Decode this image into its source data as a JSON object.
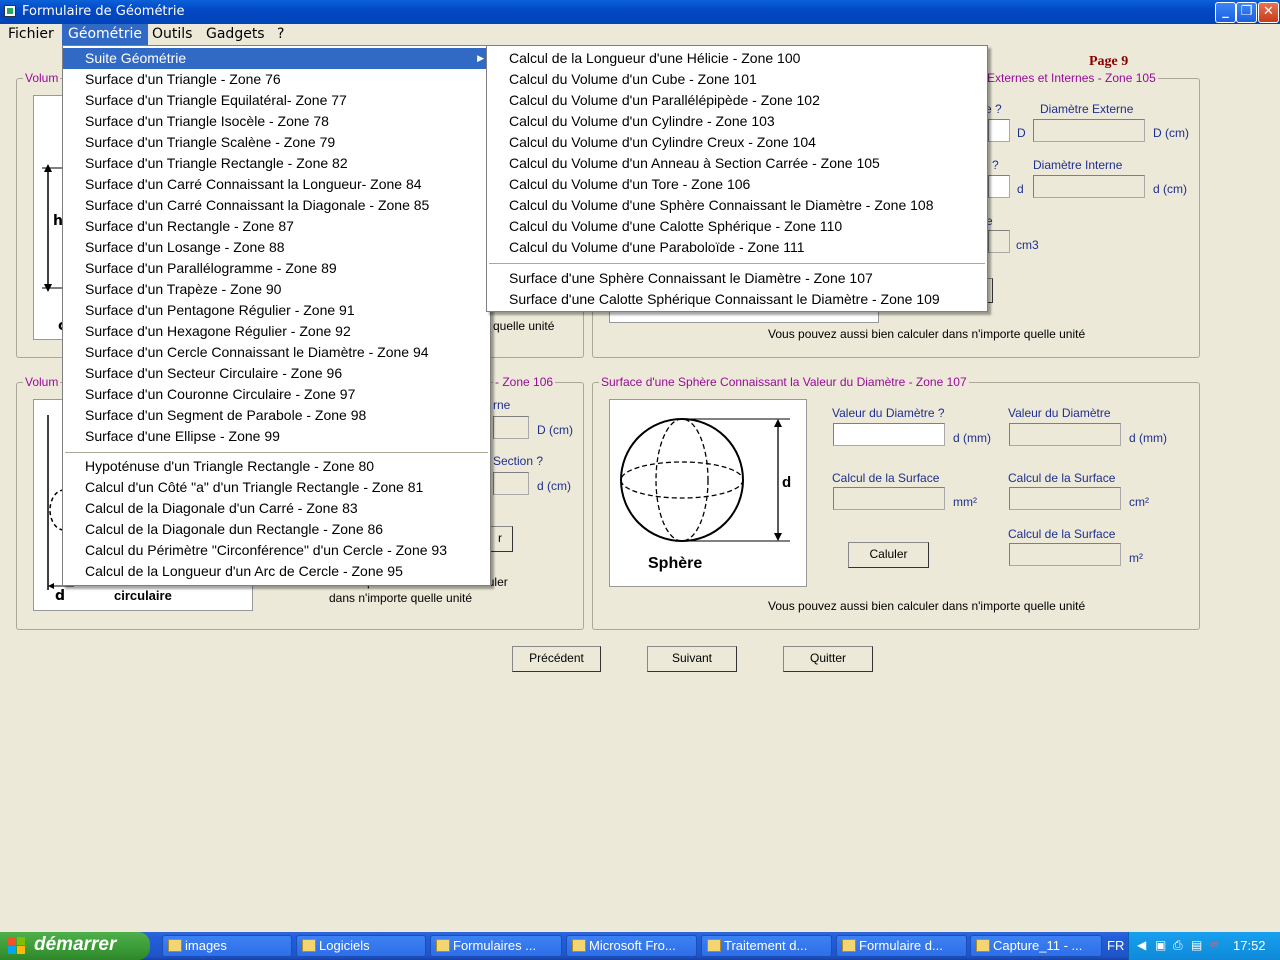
{
  "window": {
    "title": "Formulaire de Géométrie"
  },
  "menubar": [
    "Fichier",
    "Géométrie",
    "Outils",
    "Gadgets",
    "?"
  ],
  "page_label": "Page 9",
  "geo_menu": {
    "submenu_label": "Suite Géométrie",
    "group1": [
      "Surface d'un Triangle - Zone 76",
      "Surface d'un Triangle Equilatéral- Zone 77",
      "Surface d'un Triangle Isocèle - Zone 78",
      "Surface d'un Triangle Scalène - Zone 79",
      "Surface d'un Triangle Rectangle - Zone 82",
      "Surface d'un Carré Connaissant la Longueur- Zone 84",
      "Surface d'un Carré Connaissant la Diagonale - Zone 85",
      "Surface d'un Rectangle - Zone 87",
      "Surface d'un Losange - Zone 88",
      "Surface d'un Parallélogramme - Zone 89",
      "Surface d'un Trapèze - Zone 90",
      "Surface d'un Pentagone Régulier - Zone 91",
      "Surface d'un Hexagone Régulier - Zone 92",
      "Surface d'un Cercle Connaissant le Diamètre - Zone 94",
      "Surface d'un Secteur Circulaire - Zone 96",
      "Surface d'un Couronne Circulaire - Zone 97",
      "Surface d'un Segment de Parabole - Zone 98",
      "Surface d'une Ellipse - Zone 99"
    ],
    "group2": [
      "Hypoténuse d'un Triangle Rectangle - Zone 80",
      "Calcul d'un Côté \"a\" d'un Triangle Rectangle - Zone 81",
      "Calcul de la Diagonale d'un Carré - Zone 83",
      "Calcul de la Diagonale dun Rectangle - Zone 86",
      "Calcul du Périmètre \"Circonférence\" d'un Cercle - Zone 93",
      "Calcul de la Longueur d'un Arc de Cercle - Zone 95"
    ]
  },
  "suite_menu": {
    "group1": [
      "Calcul de la Longueur  d'une Hélicie - Zone 100",
      "Calcul du Volume d'un Cube - Zone 101",
      "Calcul du Volume d'un Parallélépipède - Zone 102",
      "Calcul du Volume d'un Cylindre - Zone 103",
      "Calcul du Volume d'un Cylindre Creux - Zone 104",
      "Calcul du Volume d'un Anneau à Section Carrée - Zone 105",
      "Calcul du Volume d'un Tore - Zone 106",
      "Calcul du Volume d'une Sphère Connaissant le Diamètre - Zone 108",
      "Calcul du Volume d'une Calotte Sphérique - Zone 110",
      "Calcul du Volume d'une Paraboloïde - Zone 111"
    ],
    "group2": [
      "Surface d'une Sphère Connaissant le Diamètre - Zone 107",
      "Surface d'une Calotte Sphérique Connaissant le Diamètre - Zone 109"
    ]
  },
  "panel_tl": {
    "legend": "Volum",
    "fig_letter_h": "h",
    "fig_letter_c": "c",
    "note": "quelle unité"
  },
  "panel_tr": {
    "legend": "Externes et Internes - Zone 105",
    "q1": "e ?",
    "q2": "?",
    "q3": "e",
    "lbl_ext": "Diamètre Externe",
    "lbl_int": "Diamètre Interne",
    "u_D": "D",
    "u_Dcm": "D (cm)",
    "u_d": "d",
    "u_dcm": "d (cm)",
    "u_cm3": "cm3",
    "note": "Vous pouvez aussi bien calculer dans n'importe quelle unité"
  },
  "panel_bl": {
    "legend_left": "Volum",
    "legend_right": "- Zone 106",
    "lbl_rne": "rne",
    "lbl_section": "Section ?",
    "u1": "D (cm)",
    "u2": "d (cm)",
    "btn_partial": "r",
    "fig_d": "d",
    "fig_caption": "circulaire",
    "note1": "Vous pouvez aussi bien calculer",
    "note2": "dans n'importe quelle unité"
  },
  "panel_br": {
    "legend": "Surface d'une Sphère Connaissant la Valeur du Diamètre - Zone 107",
    "lbl_val_q": "Valeur du Diamètre ?",
    "lbl_val": "Valeur du Diamètre",
    "u_dmm": "d  (mm)",
    "u_dmm2": "d  (mm)",
    "lbl_surf1": "Calcul de la Surface",
    "lbl_surf2": "Calcul de la Surface",
    "lbl_surf3": "Calcul de la Surface",
    "u_mm2": "mm²",
    "u_cm2": "cm²",
    "u_m2": "m²",
    "btn_calc": "Caluler",
    "fig_d": "d",
    "fig_caption": "Sphère",
    "note": "Vous pouvez aussi bien calculer dans n'importe quelle unité"
  },
  "nav": {
    "prev": "Précédent",
    "next": "Suivant",
    "quit": "Quitter"
  },
  "taskbar": {
    "start": "démarrer",
    "tasks": [
      "images",
      "Logiciels",
      "Formulaires ...",
      "Microsoft Fro...",
      "Traitement d...",
      "Formulaire d...",
      "Capture_11 - ..."
    ],
    "lang": "FR",
    "clock": "17:52"
  }
}
